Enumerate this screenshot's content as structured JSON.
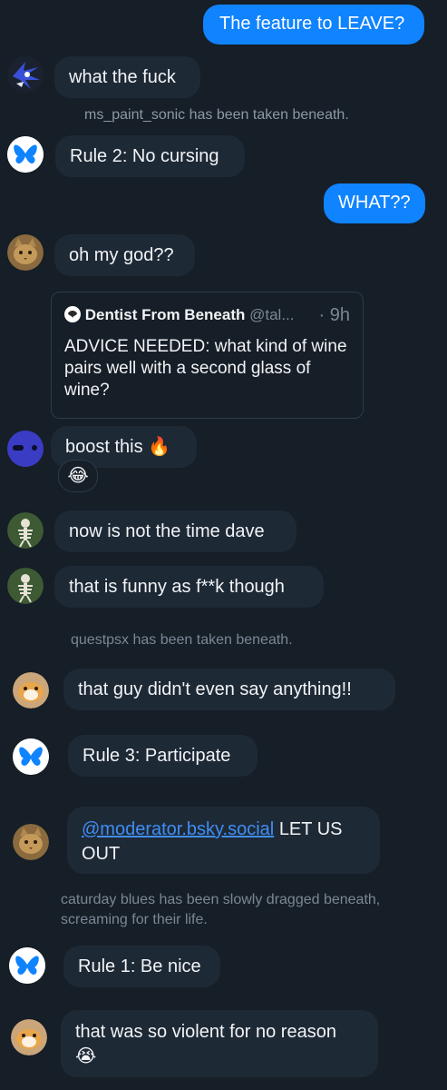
{
  "messages": {
    "m1": "The feature to LEAVE?",
    "m2": "what the fuck",
    "s1": "ms_paint_sonic has been taken beneath.",
    "m3": "Rule 2: No cursing",
    "m4": "WHAT??",
    "m5": "oh my god??",
    "m6_text": "boost this",
    "m6_emoji": "🔥",
    "m6_reaction": "😂",
    "m7": "now is not the time dave",
    "m8": "that is funny as f**k though",
    "s2": "questpsx has been taken beneath.",
    "m9": "that guy didn't even say anything!!",
    "m10": "Rule 3: Participate",
    "m11_mention": "@moderator.bsky.social",
    "m11_text": "LET US OUT",
    "s3": "caturday blues has been slowly dragged beneath, screaming for their life.",
    "m12": "Rule 1: Be nice",
    "m13_text": "that was so violent for no reason",
    "m13_emoji": "😭"
  },
  "quote_post": {
    "author": "Dentist From Beneath",
    "handle": "@tal...",
    "time": "· 9h",
    "text": "ADVICE NEEDED: what kind of wine pairs well with a second glass of wine?"
  },
  "colors": {
    "background": "#161e27",
    "bubble": "#1e2936",
    "my_bubble": "#1083fe",
    "system_text": "#7b8795",
    "link": "#3f8ef5"
  },
  "icons": {
    "avatar_sonic": "sonic-avatar-icon",
    "avatar_bluesky": "butterfly-icon",
    "avatar_cat": "cat-avatar-icon",
    "avatar_blob": "blue-blob-avatar-icon",
    "avatar_skeleton": "skeleton-avatar-icon",
    "avatar_hamster": "hamster-avatar-icon"
  }
}
